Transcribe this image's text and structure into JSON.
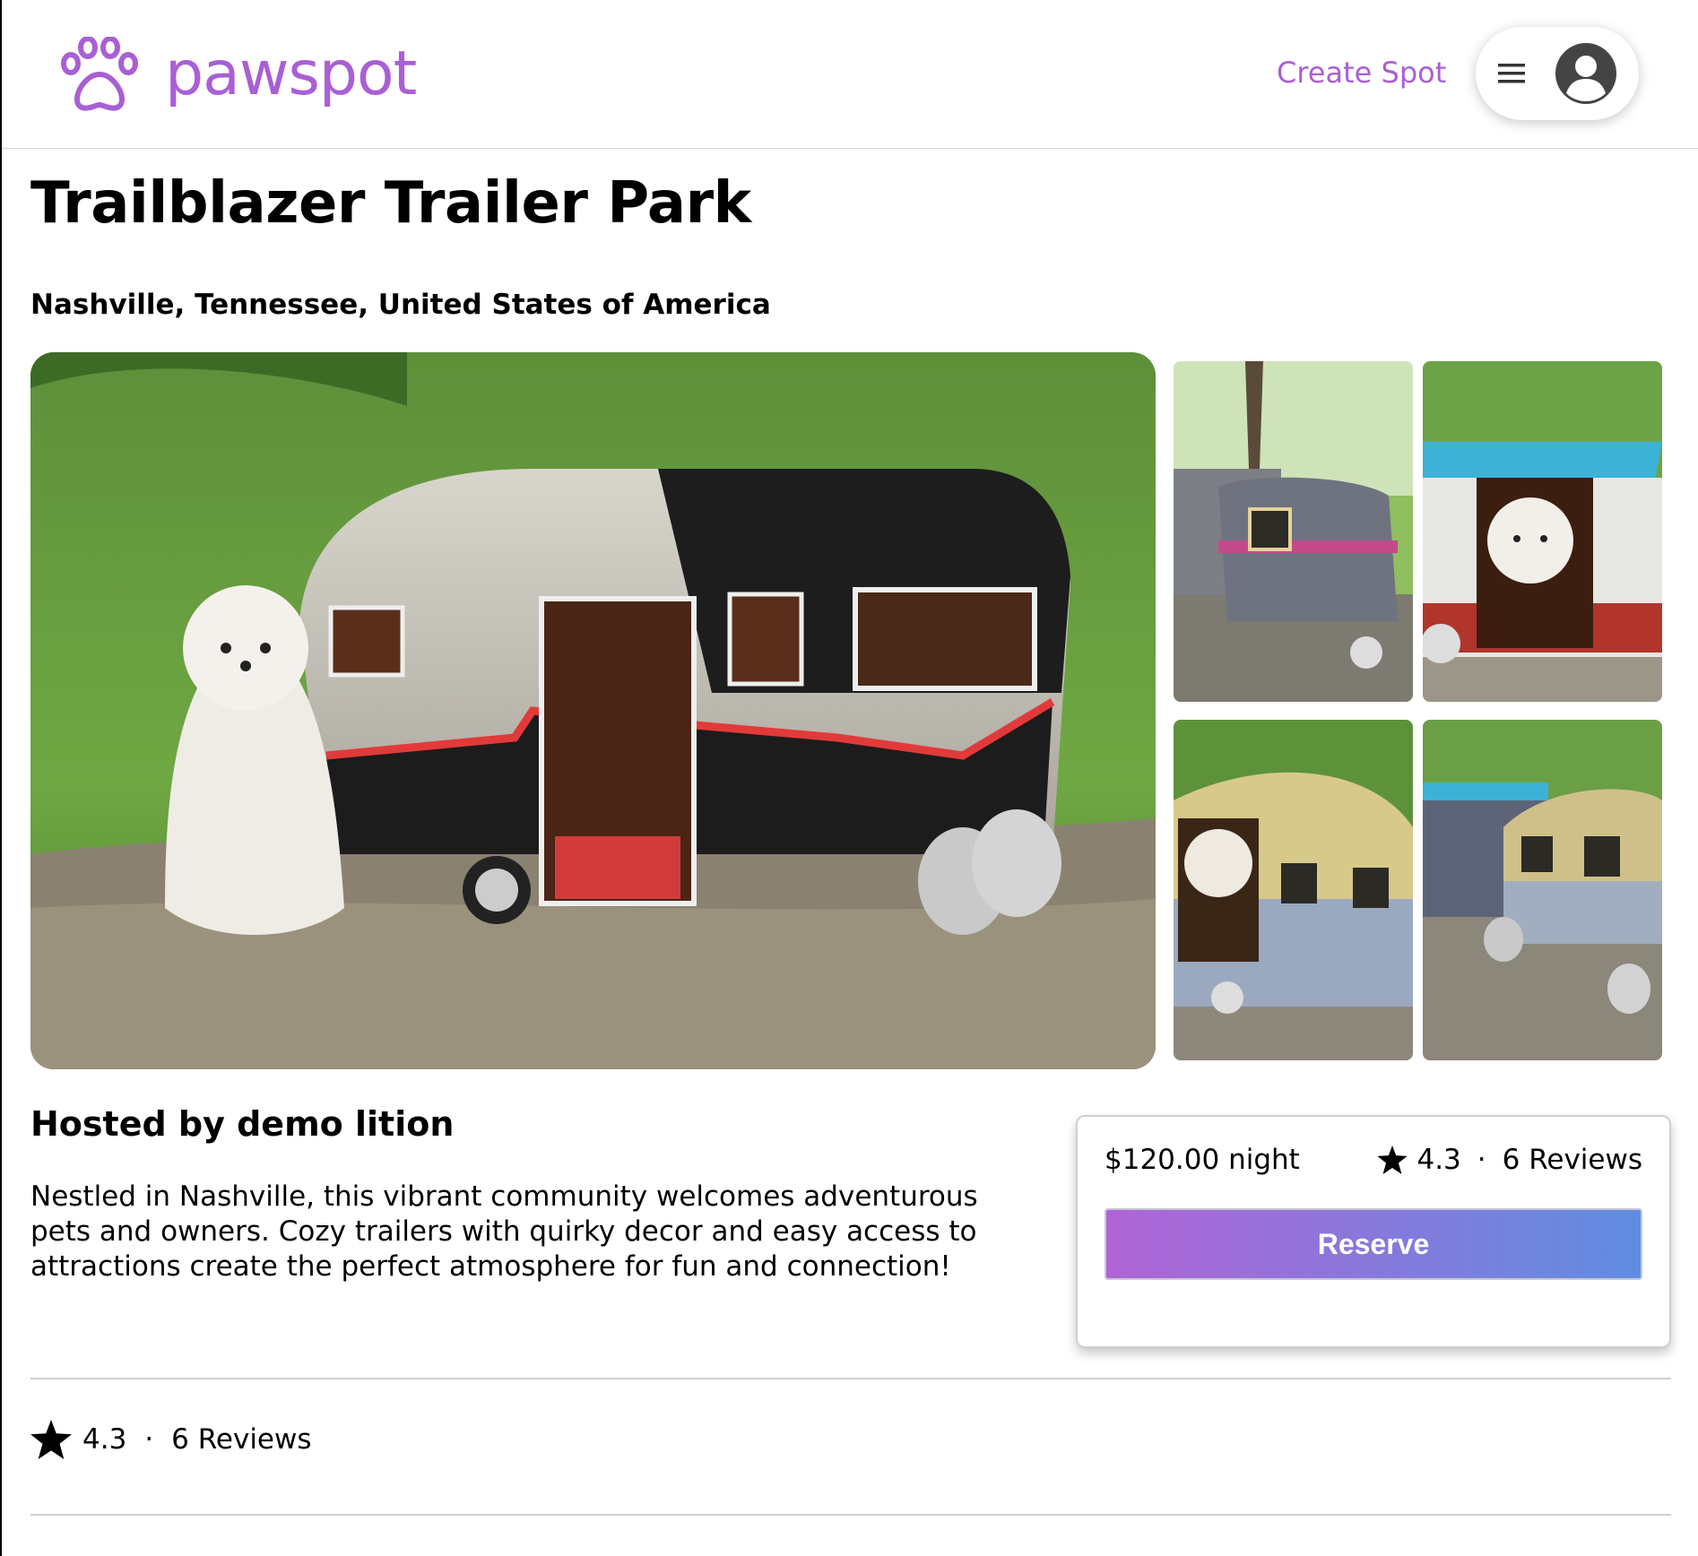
{
  "header": {
    "logo_text": "pawspot",
    "create_spot_label": "Create Spot",
    "brand_color": "#a95fd6"
  },
  "spot": {
    "title": "Trailblazer Trailer Park",
    "location": "Nashville, Tennessee, United States of America",
    "host": "Hosted by demo lition",
    "description": "Nestled in Nashville, this vibrant community welcomes adventurous pets and owners. Cozy trailers with quirky decor and easy access to attractions create the perfect atmosphere for fun and connection!"
  },
  "gallery": {
    "main_image": "dog-beside-black-and-silver-camper-doghouse",
    "thumbnails": [
      "grey-pink-trailer-doghouses",
      "dog-in-red-blue-trailer",
      "dog-in-yellow-trailer",
      "row-of-trailer-doghouses"
    ]
  },
  "reservation": {
    "price": "$120.00",
    "price_unit": "night",
    "rating": "4.3",
    "separator": "·",
    "reviews": "6 Reviews",
    "reserve_label": "Reserve",
    "gradient_start": "#b064d6",
    "gradient_end": "#5f8de0"
  },
  "reviews_section": {
    "rating": "4.3",
    "separator": "·",
    "reviews": "6 Reviews"
  },
  "icons": {
    "logo": "paw-icon",
    "menu": "hamburger-icon",
    "user": "user-avatar-icon",
    "rating": "star-icon"
  }
}
